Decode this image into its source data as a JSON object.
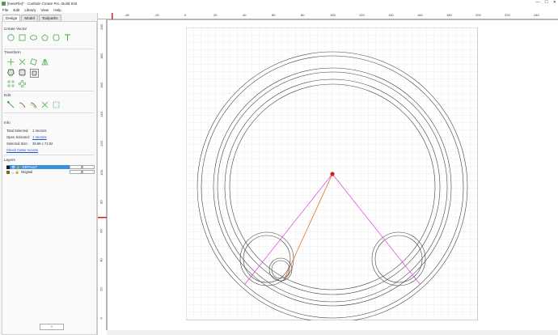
{
  "window": {
    "title": "[NewFile]* - Carbide Create Pro, Build 845",
    "controls": [
      "—",
      "☐",
      "✕"
    ]
  },
  "menu": [
    "File",
    "Edit",
    "Library",
    "View",
    "Help"
  ],
  "tabs": [
    {
      "label": "Design",
      "active": true
    },
    {
      "label": "Model",
      "active": false
    },
    {
      "label": "Toolpaths",
      "active": false
    }
  ],
  "sections": {
    "create_vector": "Create Vector",
    "transform": "Transform",
    "edit": "Edit",
    "info": "Info",
    "layers": "Layers"
  },
  "info": {
    "total_selected_label": "Total Selected:",
    "total_selected_value": "1 Vectors",
    "open_selected_label": "Open Selected:",
    "open_selected_value": "1 Vectors",
    "selected_size_label": "Selected Size:",
    "selected_size_value": "39.69 x 73.82",
    "check_cutter": "Check Cutter Access"
  },
  "layers": [
    {
      "name": "DEFAULT",
      "color": "#1a1a1a",
      "selected": true
    },
    {
      "name": "Original",
      "color": "#7a6a1a",
      "selected": false
    }
  ],
  "add_layer_label": "+",
  "ruler_top": [
    "-40",
    "-20",
    "0",
    "20",
    "40",
    "60",
    "80",
    "100",
    "120",
    "140",
    "160",
    "180",
    "200",
    "220",
    "240"
  ],
  "ruler_left": [
    "200",
    "180",
    "160",
    "140",
    "120",
    "100",
    "80",
    "60",
    "40",
    "20",
    "0"
  ],
  "colors": {
    "accent": "#3d8fd8",
    "tool_green": "#4aa84a",
    "selection_magenta": "#e040e0",
    "toolpath_orange": "#e07020",
    "origin_red": "#d42020"
  }
}
